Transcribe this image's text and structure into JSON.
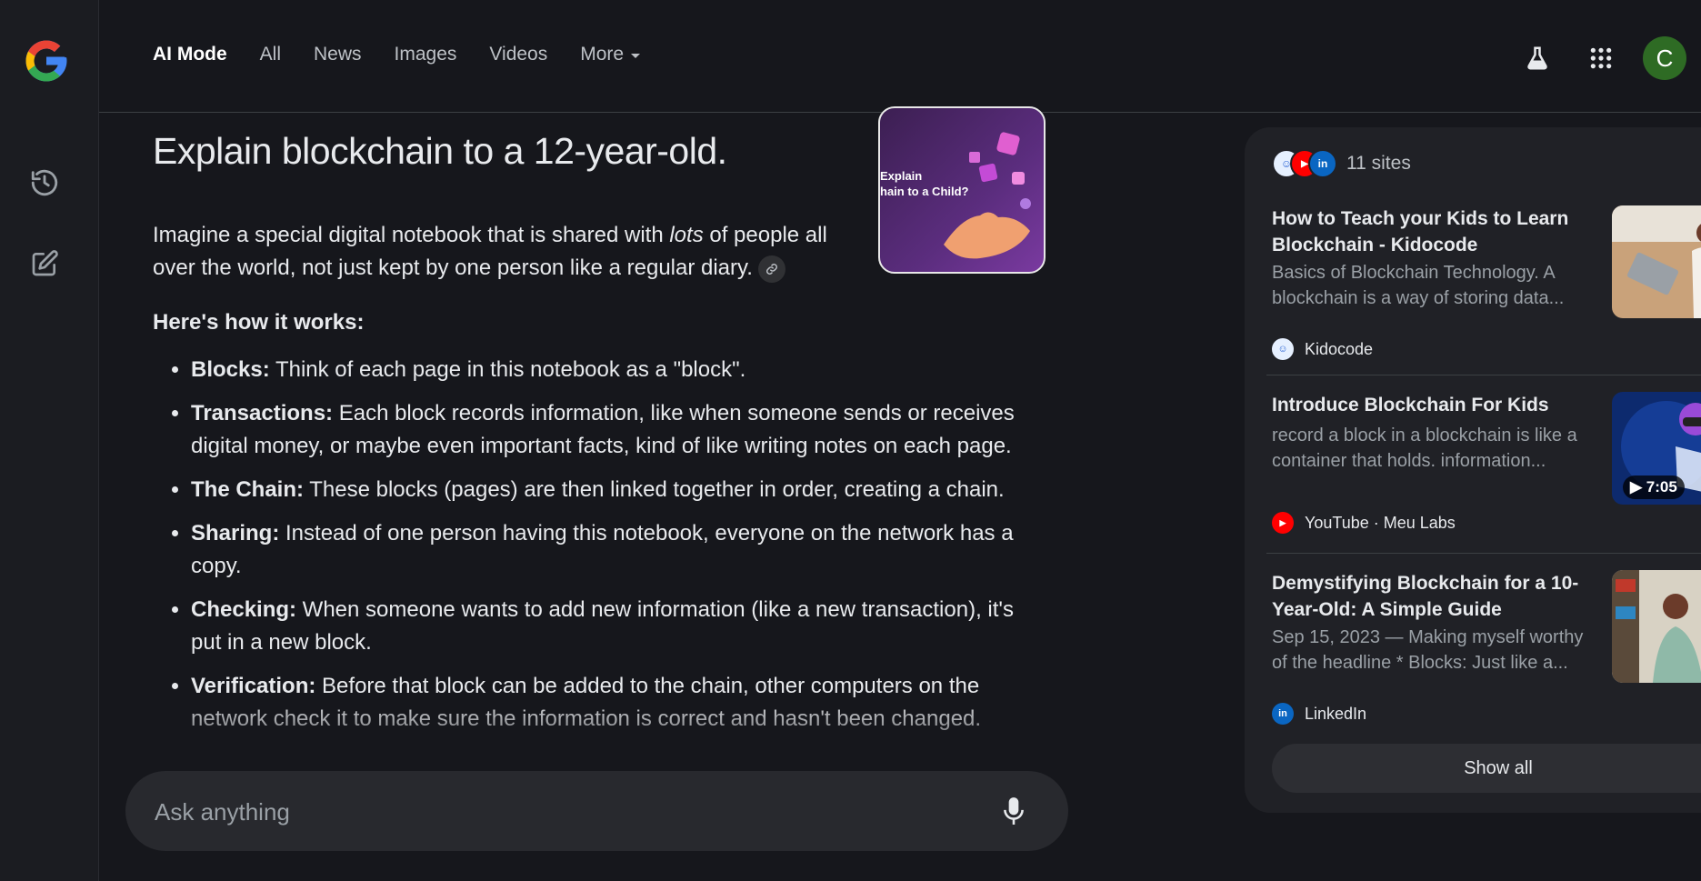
{
  "header": {
    "tabs": [
      {
        "label": "AI Mode",
        "active": true
      },
      {
        "label": "All"
      },
      {
        "label": "News"
      },
      {
        "label": "Images"
      },
      {
        "label": "Videos"
      },
      {
        "label": "More"
      }
    ],
    "avatar_letter": "C",
    "icons": [
      "labs-flask-icon",
      "apps-grid-icon"
    ]
  },
  "sidebar": {
    "icons": [
      "google-logo",
      "history-icon",
      "new-chat-icon"
    ]
  },
  "main": {
    "query": "Explain blockchain to a 12-year-old.",
    "intro_before": "Imagine a special digital notebook that is shared with ",
    "intro_em": "lots",
    "intro_after": " of people all over the world, not just kept by one person like a regular diary.",
    "how_heading": "Here's how it works:",
    "points": [
      {
        "term": "Blocks:",
        "text": " Think of each page in this notebook as a \"block\"."
      },
      {
        "term": "Transactions:",
        "text": " Each block records information, like when someone sends or receives digital money, or maybe even important facts, kind of like writing notes on each page."
      },
      {
        "term": "The Chain:",
        "text": " These blocks (pages) are then linked together in order, creating a chain."
      },
      {
        "term": "Sharing:",
        "text": " Instead of one person having this notebook, everyone on the network has a copy."
      },
      {
        "term": "Checking:",
        "text": " When someone wants to add new information (like a new transaction), it's put in a new block."
      },
      {
        "term": "Verification:",
        "text": " Before that block can be added to the chain, other computers on the network check it to make sure the information is correct and hasn't been changed."
      }
    ],
    "hero_image_text": "Explain\nhain to a Child?"
  },
  "ask": {
    "placeholder": "Ask anything"
  },
  "sources": {
    "count_label": "11 sites",
    "cards": [
      {
        "title": "How to Teach your Kids to Learn Blockchain - Kidocode",
        "snippet": "Basics of Blockchain Technology. A blockchain is a way of storing data...",
        "source": "Kidocode"
      },
      {
        "title": "Introduce Blockchain For Kids",
        "snippet": "record a block in a blockchain is like a container that holds. information...",
        "source": "YouTube · Meu Labs",
        "duration": "7:05"
      },
      {
        "title": "Demystifying Blockchain for a 10-Year-Old: A Simple Guide",
        "snippet": "Sep 15, 2023 — Making myself worthy of the headline * Blocks: Just like a...",
        "source": "LinkedIn"
      }
    ],
    "show_all_label": "Show all"
  },
  "colors": {
    "background": "#16171c",
    "panel": "#202126",
    "avatar": "#2e6b24",
    "youtube": "#ff0000",
    "linkedin": "#0a66c2"
  }
}
